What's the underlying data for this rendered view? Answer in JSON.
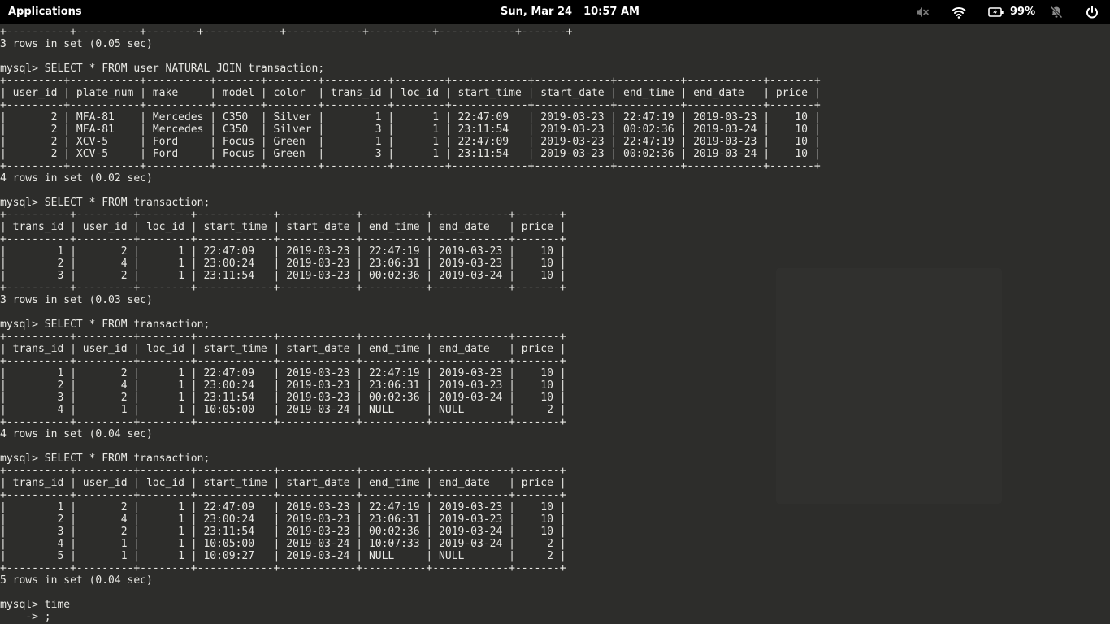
{
  "topbar": {
    "applications_label": "Applications",
    "date": "Sun, Mar 24",
    "time": "10:57 AM",
    "battery_percent": "99%",
    "icons": [
      "volume-muted-icon",
      "wifi-icon",
      "battery-charging-icon",
      "notifications-off-icon",
      "power-icon"
    ]
  },
  "terminal": {
    "lines": [
      "+----------+----------+--------+------------+------------+----------+------------+-------+",
      "3 rows in set (0.05 sec)",
      "",
      "mysql> SELECT * FROM user NATURAL JOIN transaction;",
      "+---------+-----------+----------+-------+--------+----------+--------+------------+------------+----------+------------+-------+",
      "| user_id | plate_num | make     | model | color  | trans_id | loc_id | start_time | start_date | end_time | end_date   | price |",
      "+---------+-----------+----------+-------+--------+----------+--------+------------+------------+----------+------------+-------+",
      "|       2 | MFA-81    | Mercedes | C350  | Silver |        1 |      1 | 22:47:09   | 2019-03-23 | 22:47:19 | 2019-03-23 |    10 |",
      "|       2 | MFA-81    | Mercedes | C350  | Silver |        3 |      1 | 23:11:54   | 2019-03-23 | 00:02:36 | 2019-03-24 |    10 |",
      "|       2 | XCV-5     | Ford     | Focus | Green  |        1 |      1 | 22:47:09   | 2019-03-23 | 22:47:19 | 2019-03-23 |    10 |",
      "|       2 | XCV-5     | Ford     | Focus | Green  |        3 |      1 | 23:11:54   | 2019-03-23 | 00:02:36 | 2019-03-24 |    10 |",
      "+---------+-----------+----------+-------+--------+----------+--------+------------+------------+----------+------------+-------+",
      "4 rows in set (0.02 sec)",
      "",
      "mysql> SELECT * FROM transaction;",
      "+----------+---------+--------+------------+------------+----------+------------+-------+",
      "| trans_id | user_id | loc_id | start_time | start_date | end_time | end_date   | price |",
      "+----------+---------+--------+------------+------------+----------+------------+-------+",
      "|        1 |       2 |      1 | 22:47:09   | 2019-03-23 | 22:47:19 | 2019-03-23 |    10 |",
      "|        2 |       4 |      1 | 23:00:24   | 2019-03-23 | 23:06:31 | 2019-03-23 |    10 |",
      "|        3 |       2 |      1 | 23:11:54   | 2019-03-23 | 00:02:36 | 2019-03-24 |    10 |",
      "+----------+---------+--------+------------+------------+----------+------------+-------+",
      "3 rows in set (0.03 sec)",
      "",
      "mysql> SELECT * FROM transaction;",
      "+----------+---------+--------+------------+------------+----------+------------+-------+",
      "| trans_id | user_id | loc_id | start_time | start_date | end_time | end_date   | price |",
      "+----------+---------+--------+------------+------------+----------+------------+-------+",
      "|        1 |       2 |      1 | 22:47:09   | 2019-03-23 | 22:47:19 | 2019-03-23 |    10 |",
      "|        2 |       4 |      1 | 23:00:24   | 2019-03-23 | 23:06:31 | 2019-03-23 |    10 |",
      "|        3 |       2 |      1 | 23:11:54   | 2019-03-23 | 00:02:36 | 2019-03-24 |    10 |",
      "|        4 |       1 |      1 | 10:05:00   | 2019-03-24 | NULL     | NULL       |     2 |",
      "+----------+---------+--------+------------+------------+----------+------------+-------+",
      "4 rows in set (0.04 sec)",
      "",
      "mysql> SELECT * FROM transaction;",
      "+----------+---------+--------+------------+------------+----------+------------+-------+",
      "| trans_id | user_id | loc_id | start_time | start_date | end_time | end_date   | price |",
      "+----------+---------+--------+------------+------------+----------+------------+-------+",
      "|        1 |       2 |      1 | 22:47:09   | 2019-03-23 | 22:47:19 | 2019-03-23 |    10 |",
      "|        2 |       4 |      1 | 23:00:24   | 2019-03-23 | 23:06:31 | 2019-03-23 |    10 |",
      "|        3 |       2 |      1 | 23:11:54   | 2019-03-23 | 00:02:36 | 2019-03-24 |    10 |",
      "|        4 |       1 |      1 | 10:05:00   | 2019-03-24 | 10:07:33 | 2019-03-24 |     2 |",
      "|        5 |       1 |      1 | 10:09:27   | 2019-03-24 | NULL     | NULL       |     2 |",
      "+----------+---------+--------+------------+------------+----------+------------+-------+",
      "5 rows in set (0.04 sec)",
      "",
      "mysql> time",
      "    -> ;"
    ]
  }
}
